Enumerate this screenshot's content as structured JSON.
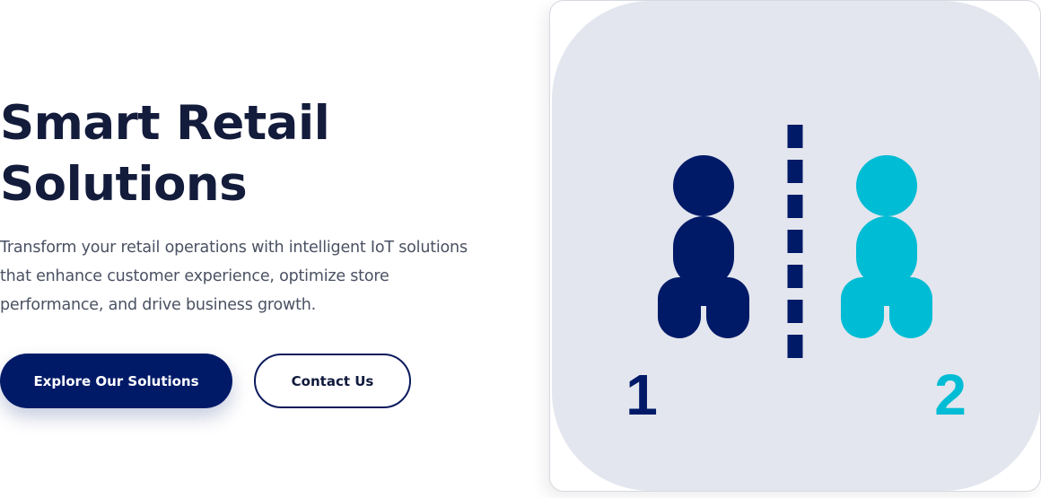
{
  "hero": {
    "title_lines": [
      "Smart Retail",
      "Solutions"
    ],
    "description_lines": [
      "Transform your retail operations with intelligent IoT solutions",
      "that enhance customer experience, optimize store",
      "performance, and drive business growth."
    ],
    "primary_button": "Explore Our Solutions",
    "secondary_button": "Contact Us"
  },
  "illustration": {
    "icon": "social-distancing-icon",
    "person_1_label": "1",
    "person_2_label": "2"
  },
  "colors": {
    "navy": "#001a68",
    "cyan": "#00bcd4",
    "panel_bg": "#e3e6ee",
    "title_text": "#141c3c",
    "body_text": "#4a5162"
  }
}
